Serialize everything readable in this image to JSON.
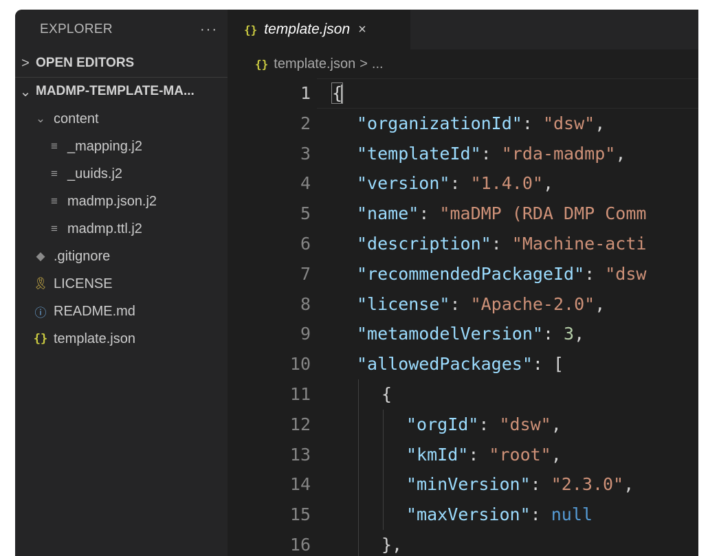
{
  "sidebar": {
    "title": "EXPLORER",
    "more": "···",
    "open_editors": {
      "chevron": ">",
      "label": "OPEN EDITORS"
    },
    "project": {
      "chevron": "⌄",
      "label": "MADMP-TEMPLATE-MA..."
    },
    "tree": [
      {
        "label": "content",
        "icon": "chevron-down-icon",
        "glyph": "⌄",
        "indent": 1
      },
      {
        "label": "_mapping.j2",
        "icon": "lines-file-icon",
        "glyph": "≡",
        "indent": 2
      },
      {
        "label": "_uuids.j2",
        "icon": "lines-file-icon",
        "glyph": "≡",
        "indent": 2
      },
      {
        "label": "madmp.json.j2",
        "icon": "lines-file-icon",
        "glyph": "≡",
        "indent": 2
      },
      {
        "label": "madmp.ttl.j2",
        "icon": "lines-file-icon",
        "glyph": "≡",
        "indent": 2
      },
      {
        "label": ".gitignore",
        "icon": "git-icon",
        "glyph": "◆",
        "indent": 1
      },
      {
        "label": "LICENSE",
        "icon": "license-key-icon",
        "glyph": "🎗",
        "indent": 1
      },
      {
        "label": "README.md",
        "icon": "info-icon",
        "glyph": "ⓘ",
        "indent": 1
      },
      {
        "label": "template.json",
        "icon": "json-braces-icon",
        "glyph": "{}",
        "indent": 1
      }
    ]
  },
  "tab": {
    "icon": "{}",
    "label": "template.json",
    "close": "×"
  },
  "breadcrumb": {
    "icon": "{}",
    "file": "template.json",
    "sep": ">",
    "rest": "..."
  },
  "colors": {
    "key": "#9cdcfe",
    "string": "#ce9178",
    "number": "#b5cea8",
    "keyword": "#569cd6"
  },
  "code": [
    {
      "n": "1",
      "indent": 0,
      "tokens": [
        [
          "p",
          "{"
        ]
      ]
    },
    {
      "n": "2",
      "indent": 1,
      "tokens": [
        [
          "k",
          "\"organizationId\""
        ],
        [
          "p",
          ": "
        ],
        [
          "s",
          "\"dsw\""
        ],
        [
          "p",
          ","
        ]
      ]
    },
    {
      "n": "3",
      "indent": 1,
      "tokens": [
        [
          "k",
          "\"templateId\""
        ],
        [
          "p",
          ": "
        ],
        [
          "s",
          "\"rda-madmp\""
        ],
        [
          "p",
          ","
        ]
      ]
    },
    {
      "n": "4",
      "indent": 1,
      "tokens": [
        [
          "k",
          "\"version\""
        ],
        [
          "p",
          ": "
        ],
        [
          "s",
          "\"1.4.0\""
        ],
        [
          "p",
          ","
        ]
      ]
    },
    {
      "n": "5",
      "indent": 1,
      "tokens": [
        [
          "k",
          "\"name\""
        ],
        [
          "p",
          ": "
        ],
        [
          "s",
          "\"maDMP (RDA DMP Comm"
        ]
      ]
    },
    {
      "n": "6",
      "indent": 1,
      "tokens": [
        [
          "k",
          "\"description\""
        ],
        [
          "p",
          ": "
        ],
        [
          "s",
          "\"Machine-acti"
        ]
      ]
    },
    {
      "n": "7",
      "indent": 1,
      "tokens": [
        [
          "k",
          "\"recommendedPackageId\""
        ],
        [
          "p",
          ": "
        ],
        [
          "s",
          "\"dsw"
        ]
      ]
    },
    {
      "n": "8",
      "indent": 1,
      "tokens": [
        [
          "k",
          "\"license\""
        ],
        [
          "p",
          ": "
        ],
        [
          "s",
          "\"Apache-2.0\""
        ],
        [
          "p",
          ","
        ]
      ]
    },
    {
      "n": "9",
      "indent": 1,
      "tokens": [
        [
          "k",
          "\"metamodelVersion\""
        ],
        [
          "p",
          ": "
        ],
        [
          "n",
          "3"
        ],
        [
          "p",
          ","
        ]
      ]
    },
    {
      "n": "10",
      "indent": 1,
      "tokens": [
        [
          "k",
          "\"allowedPackages\""
        ],
        [
          "p",
          ": ["
        ]
      ]
    },
    {
      "n": "11",
      "indent": 2,
      "tokens": [
        [
          "p",
          "{"
        ]
      ]
    },
    {
      "n": "12",
      "indent": 3,
      "tokens": [
        [
          "k",
          "\"orgId\""
        ],
        [
          "p",
          ": "
        ],
        [
          "s",
          "\"dsw\""
        ],
        [
          "p",
          ","
        ]
      ]
    },
    {
      "n": "13",
      "indent": 3,
      "tokens": [
        [
          "k",
          "\"kmId\""
        ],
        [
          "p",
          ": "
        ],
        [
          "s",
          "\"root\""
        ],
        [
          "p",
          ","
        ]
      ]
    },
    {
      "n": "14",
      "indent": 3,
      "tokens": [
        [
          "k",
          "\"minVersion\""
        ],
        [
          "p",
          ": "
        ],
        [
          "s",
          "\"2.3.0\""
        ],
        [
          "p",
          ","
        ]
      ]
    },
    {
      "n": "15",
      "indent": 3,
      "tokens": [
        [
          "k",
          "\"maxVersion\""
        ],
        [
          "p",
          ": "
        ],
        [
          "kw",
          "null"
        ]
      ]
    },
    {
      "n": "16",
      "indent": 2,
      "tokens": [
        [
          "p",
          "},"
        ]
      ]
    }
  ]
}
